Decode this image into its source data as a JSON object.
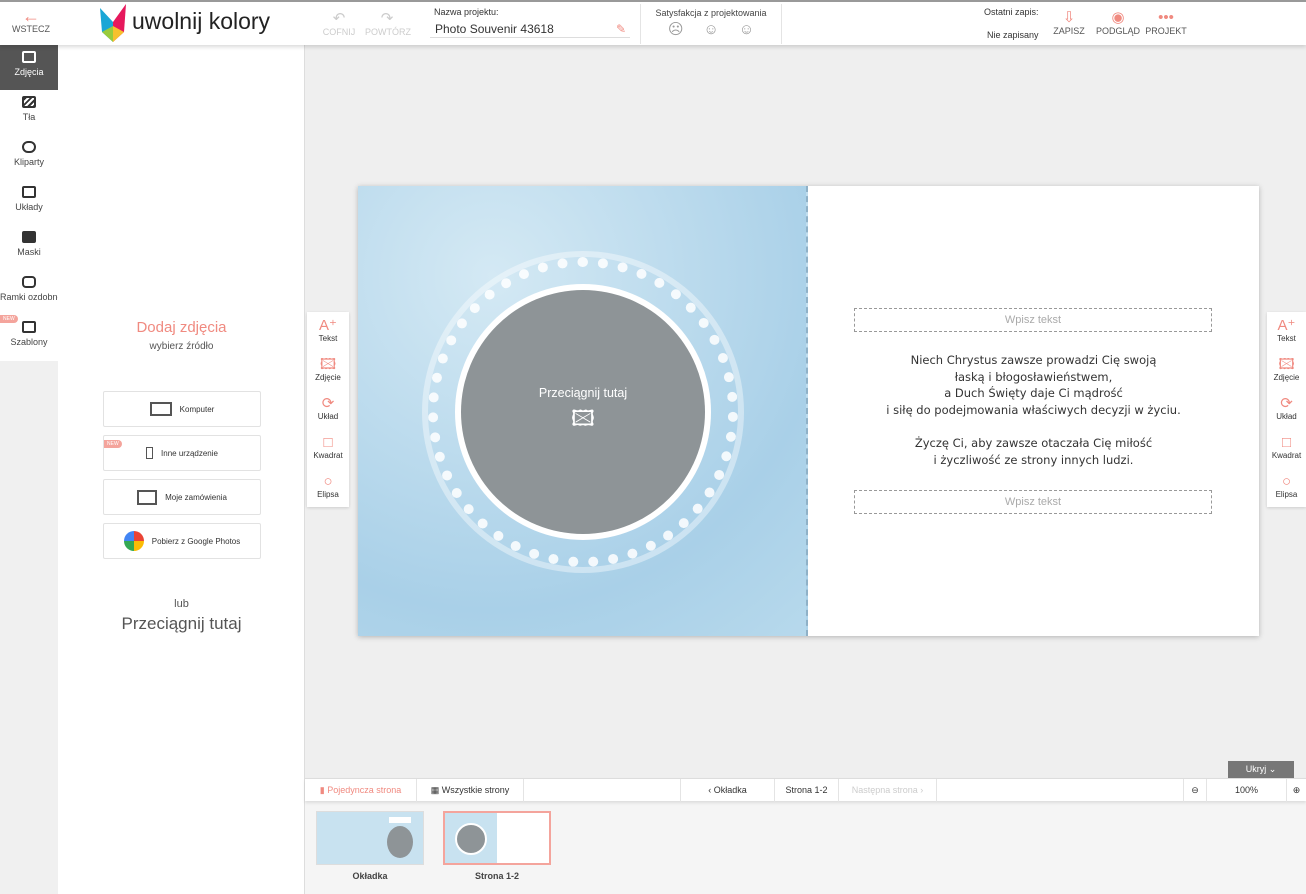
{
  "header": {
    "back": "WSTECZ",
    "logo": "uwolnij kolory",
    "undo": "COFNIJ",
    "redo": "POWTÓRZ",
    "project_name_label": "Nazwa projektu:",
    "project_name": "Photo Souvenir 43618",
    "satisfaction_label": "Satysfakcja z projektowania",
    "last_save_label": "Ostatni zapis:",
    "last_save_value": "Nie zapisany",
    "save": "ZAPISZ",
    "preview": "PODGLĄD",
    "project": "PROJEKT"
  },
  "rail": [
    {
      "label": "Zdjęcia"
    },
    {
      "label": "Tła"
    },
    {
      "label": "Kliparty"
    },
    {
      "label": "Układy"
    },
    {
      "label": "Maski"
    },
    {
      "label": "Ramki ozdobne"
    },
    {
      "label": "Szablony",
      "badge": "NEW"
    }
  ],
  "panel": {
    "title": "Dodaj zdjęcia",
    "subtitle": "wybierz źródło",
    "sources": [
      {
        "label": "Komputer"
      },
      {
        "label": "Inne urządzenie",
        "badge": "NEW"
      },
      {
        "label": "Moje zamówienia"
      },
      {
        "label": "Pobierz z Google Photos"
      }
    ],
    "or": "lub",
    "drop": "Przeciągnij tutaj"
  },
  "side_tools": [
    "Tekst",
    "Zdjęcie",
    "Układ",
    "Kwadrat",
    "Elipsa"
  ],
  "page": {
    "drop_here": "Przeciągnij tutaj",
    "text_placeholder": "Wpisz tekst",
    "verse1": [
      "Niech Chrystus zawsze prowadzi Cię swoją",
      "łaską i błogosławieństwem,",
      "a Duch Święty daje Ci mądrość",
      "i siłę do podejmowania właściwych decyzji w życiu."
    ],
    "verse2": [
      "Życzę Ci, aby zawsze otaczała Cię miłość",
      "i życzliwość ze strony innych ludzi."
    ]
  },
  "bottom": {
    "hide": "Ukryj",
    "single": "Pojedyncza strona",
    "all": "Wszystkie strony",
    "prev": "Okładka",
    "current": "Strona 1-2",
    "next": "Następna strona",
    "zoom": "100%"
  },
  "thumbs": [
    {
      "label": "Okładka"
    },
    {
      "label": "Strona 1-2"
    }
  ],
  "colors": {
    "accent": "#f08a80"
  }
}
